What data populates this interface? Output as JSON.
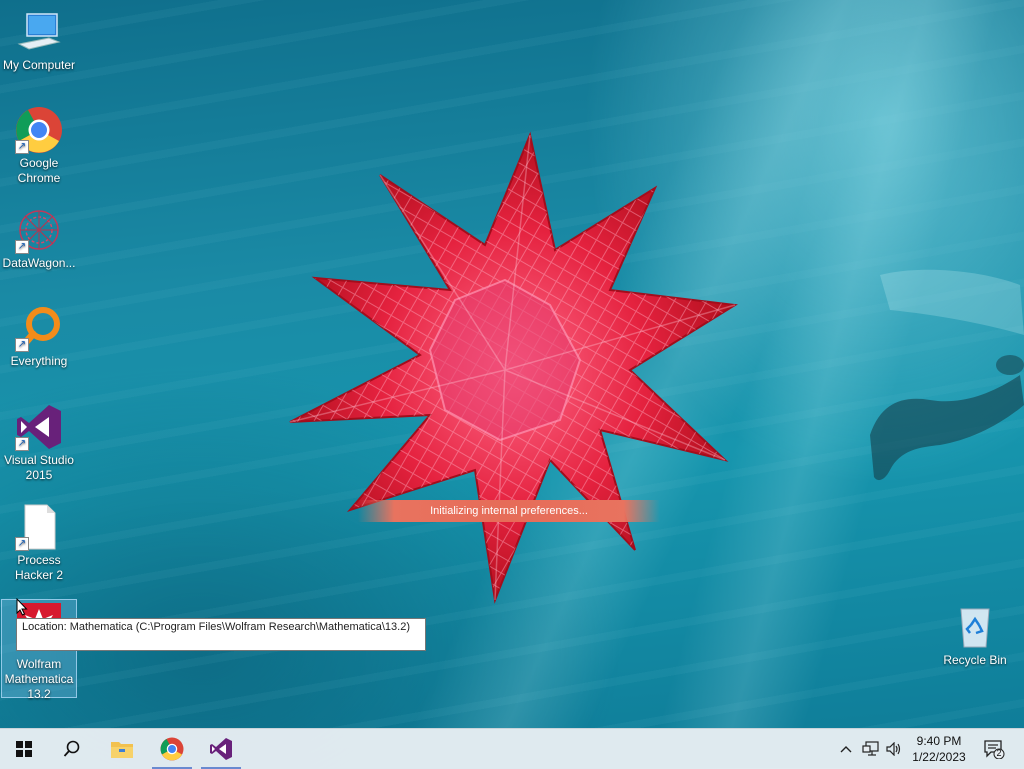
{
  "desktop": {
    "icons": [
      {
        "label": "My Computer",
        "icon": "my-computer-icon"
      },
      {
        "label": "Google Chrome",
        "icon": "chrome-icon"
      },
      {
        "label": "DataWagon...",
        "icon": "datawagon-icon"
      },
      {
        "label": "Everything",
        "icon": "everything-icon"
      },
      {
        "label": "Visual Studio 2015",
        "icon": "visual-studio-icon"
      },
      {
        "label": "Process Hacker 2",
        "icon": "process-hacker-icon"
      },
      {
        "label": "Wolfram Mathematica 13.2",
        "icon": "mathematica-icon"
      }
    ],
    "recycle_bin": {
      "label": "Recycle Bin",
      "icon": "recycle-bin-icon"
    }
  },
  "splash": {
    "status": "Initializing internal preferences...",
    "accent": "#e8735f",
    "logo_color": "#e5223f"
  },
  "tooltip": {
    "text": "Location: Mathematica (C:\\Program Files\\Wolfram Research\\Mathematica\\13.2)"
  },
  "taskbar": {
    "buttons": [
      "start-icon",
      "search-icon",
      "file-explorer-icon",
      "chrome-icon",
      "visual-studio-icon"
    ],
    "tray_icons": [
      "chevron-up-icon",
      "network-icon",
      "volume-icon"
    ],
    "time": "9:40 PM",
    "date": "1/22/2023",
    "notification_count": "2"
  }
}
